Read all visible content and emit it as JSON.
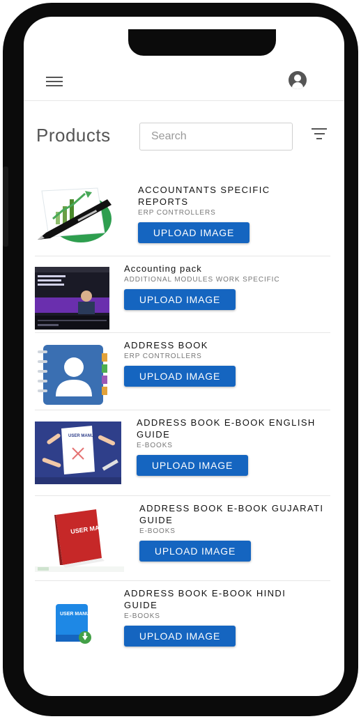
{
  "header": {
    "menu_icon": "menu-icon",
    "account_icon": "account-circle-icon"
  },
  "toolbar": {
    "title": "Products",
    "search_placeholder": "Search",
    "filter_icon": "filter-list-icon"
  },
  "products": [
    {
      "name": "ACCOUNTANTS SPECIFIC REPORTS",
      "category": "ERP CONTROLLERS",
      "button": "UPLOAD IMAGE",
      "thumb": "pen-chart-icon"
    },
    {
      "name": "Accounting pack",
      "category": "ADDITIONAL MODULES WORK SPECIFIC",
      "button": "UPLOAD IMAGE",
      "thumb": "video-screenshot"
    },
    {
      "name": "ADDRESS BOOK",
      "category": "ERP CONTROLLERS",
      "button": "UPLOAD IMAGE",
      "thumb": "address-book-icon"
    },
    {
      "name": "ADDRESS BOOK E-BOOK ENGLISH GUIDE",
      "category": "E-BOOKS",
      "button": "UPLOAD IMAGE",
      "thumb": "user-manual-illustration",
      "thumb_text": "USER MANUAL"
    },
    {
      "name": "ADDRESS BOOK E-BOOK GUJARATI GUIDE",
      "category": "E-BOOKS",
      "button": "UPLOAD IMAGE",
      "thumb": "red-manual-book",
      "thumb_text": "USER MANUAL"
    },
    {
      "name": "ADDRESS BOOK E-BOOK HINDI GUIDE",
      "category": "E-BOOKS",
      "button": "UPLOAD IMAGE",
      "thumb": "blue-manual-book",
      "thumb_text": "USER MANUAL"
    }
  ],
  "colors": {
    "primary": "#1565c0",
    "phone_frame": "#0b0b0b"
  }
}
